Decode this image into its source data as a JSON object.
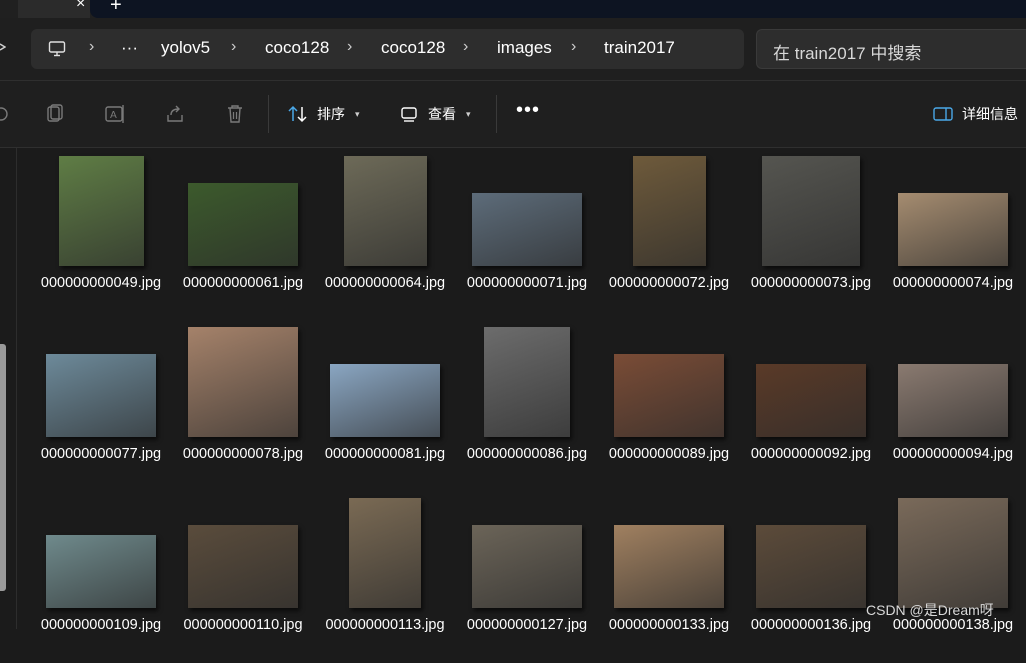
{
  "tabs": {
    "close_glyph": "×",
    "new_glyph": "+"
  },
  "address": {
    "ellipsis": "···",
    "crumbs": [
      "yolov5",
      "coco128",
      "coco128",
      "images",
      "train2017"
    ]
  },
  "search": {
    "placeholder": "在 train2017 中搜索"
  },
  "toolbar": {
    "sort_label": "排序",
    "view_label": "查看",
    "details_label": "详细信息",
    "more_glyph": "•••"
  },
  "files": [
    {
      "name": "000000000049.jpg",
      "color": "#5f7d45"
    },
    {
      "name": "000000000061.jpg",
      "color": "#3c5a2c"
    },
    {
      "name": "000000000064.jpg",
      "color": "#6d6a58"
    },
    {
      "name": "000000000071.jpg",
      "color": "#5d6c7a"
    },
    {
      "name": "000000000072.jpg",
      "color": "#6e5a3b"
    },
    {
      "name": "000000000073.jpg",
      "color": "#555550"
    },
    {
      "name": "000000000074.jpg",
      "color": "#a58c70"
    },
    {
      "name": "000000000077.jpg",
      "color": "#6d8a9a"
    },
    {
      "name": "000000000078.jpg",
      "color": "#a5826a"
    },
    {
      "name": "000000000081.jpg",
      "color": "#8aa6c2"
    },
    {
      "name": "000000000086.jpg",
      "color": "#6c6c6c"
    },
    {
      "name": "000000000089.jpg",
      "color": "#7a4c36"
    },
    {
      "name": "000000000092.jpg",
      "color": "#5a3a28"
    },
    {
      "name": "000000000094.jpg",
      "color": "#8a7a70"
    },
    {
      "name": "000000000109.jpg",
      "color": "#6f8a8c"
    },
    {
      "name": "000000000110.jpg",
      "color": "#5a4c3c"
    },
    {
      "name": "000000000113.jpg",
      "color": "#7a6a54"
    },
    {
      "name": "000000000127.jpg",
      "color": "#6b6458"
    },
    {
      "name": "000000000133.jpg",
      "color": "#a08060"
    },
    {
      "name": "000000000136.jpg",
      "color": "#5c4b3a"
    },
    {
      "name": "000000000138.jpg",
      "color": "#7a6a5a"
    }
  ],
  "watermark": "CSDN @是Dream呀"
}
